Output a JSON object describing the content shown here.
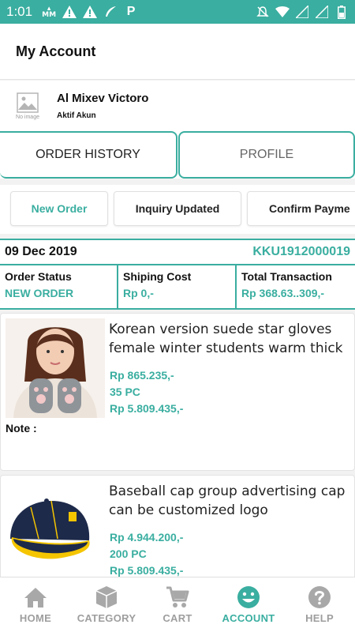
{
  "status_bar": {
    "time": "1:01",
    "icons_left": [
      "mm-icon",
      "warning-icon",
      "feather-icon",
      "p-icon"
    ],
    "icons_right": [
      "notifications-off-icon",
      "wifi-icon",
      "signal-icon",
      "signal-icon",
      "battery-icon"
    ]
  },
  "header": {
    "title": "My Account"
  },
  "profile": {
    "avatar_placeholder": "No image",
    "name": "Al Mixev Victoro",
    "status": "Aktif Akun"
  },
  "main_tabs": [
    {
      "label": "ORDER HISTORY",
      "active": true
    },
    {
      "label": "PROFILE",
      "active": false
    }
  ],
  "filter_chips": [
    {
      "label": "New Order",
      "active": true
    },
    {
      "label": "Inquiry Updated",
      "active": false
    },
    {
      "label": "Confirm Payme",
      "active": false
    }
  ],
  "order": {
    "date": "09 Dec 2019",
    "code": "KKU1912000019",
    "status_label": "Order Status",
    "status_value": "NEW ORDER",
    "shipping_label": "Shiping Cost",
    "shipping_value": "Rp 0,-",
    "total_label": "Total Transaction",
    "total_value": "Rp 368.63..309,-"
  },
  "products": [
    {
      "title": "Korean version suede star gloves female winter students warm thick ...",
      "price": "Rp 865.235,-",
      "qty": "35 PC",
      "total": "Rp 5.809.435,-",
      "note_label": "Note :"
    },
    {
      "title": "Baseball cap group advertising cap can be customized logo",
      "price": "Rp 4.944.200,-",
      "qty": "200 PC",
      "total": "Rp 5.809.435,-"
    }
  ],
  "bottom_nav": [
    {
      "label": "HOME",
      "icon": "home-icon",
      "active": false
    },
    {
      "label": "CATEGORY",
      "icon": "box-icon",
      "active": false
    },
    {
      "label": "CART",
      "icon": "cart-icon",
      "active": false
    },
    {
      "label": "ACCOUNT",
      "icon": "smiley-icon",
      "active": true
    },
    {
      "label": "HELP",
      "icon": "help-icon",
      "active": false
    }
  ],
  "colors": {
    "accent": "#3aaea0",
    "inactive": "#9e9e9e"
  }
}
